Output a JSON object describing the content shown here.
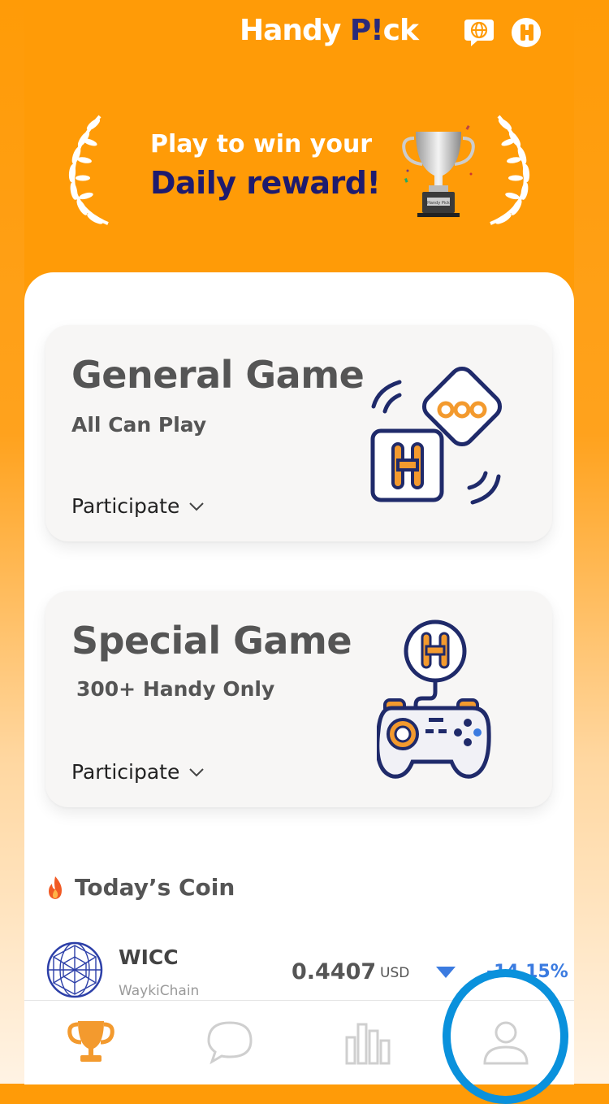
{
  "header": {
    "logo_text": "Handy ",
    "logo_mark": "P!",
    "logo_tail": "ck",
    "language_icon": "globe-chat-icon",
    "coin_icon": "handy-coin-icon"
  },
  "banner": {
    "line1": "Play to win your",
    "line2": "Daily reward!",
    "trophy_label": "Handy Pick"
  },
  "games": [
    {
      "title": "General Game",
      "subtitle": "All Can Play",
      "action": "Participate",
      "icon": "dice-icon"
    },
    {
      "title": "Special Game",
      "subtitle": "300+ Handy Only",
      "action": "Participate",
      "icon": "gamepad-icon"
    }
  ],
  "coins": {
    "heading": "Today’s Coin",
    "items": [
      {
        "symbol": "WICC",
        "name": "WaykiChain",
        "price": "0.4407",
        "currency": "USD",
        "change": "-14.15%",
        "trend": "down"
      }
    ]
  },
  "nav": {
    "items": [
      {
        "name": "trophy",
        "icon": "trophy-icon",
        "active": true
      },
      {
        "name": "chat",
        "icon": "chat-bubble-icon",
        "active": false
      },
      {
        "name": "stats",
        "icon": "bar-chart-icon",
        "active": false
      },
      {
        "name": "profile",
        "icon": "user-icon",
        "active": false
      }
    ]
  },
  "colors": {
    "brand_orange": "#ff9b07",
    "navy": "#1e1b6e",
    "down_blue": "#3b7be0",
    "highlight_circle": "#0a91dc"
  }
}
